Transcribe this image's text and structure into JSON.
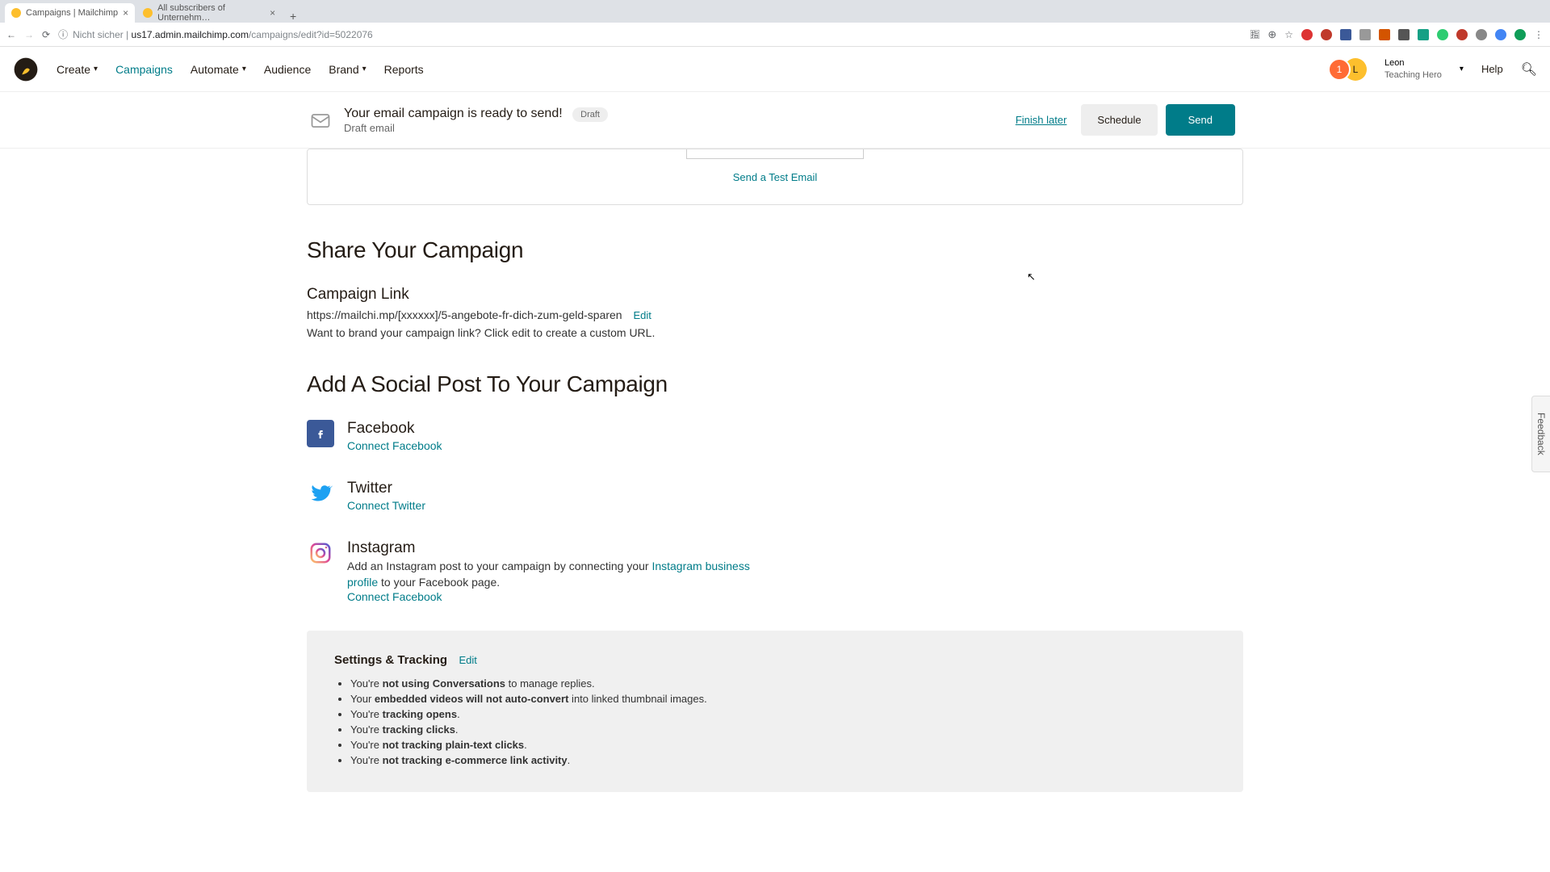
{
  "browser": {
    "tabs": [
      {
        "title": "Campaigns | Mailchimp"
      },
      {
        "title": "All subscribers of Unternehm…"
      }
    ],
    "url": {
      "prefix": "Nicht sicher | ",
      "host": "us17.admin.mailchimp.com",
      "path": "/campaigns/edit?id=5022076"
    }
  },
  "header": {
    "nav": {
      "create": "Create",
      "campaigns": "Campaigns",
      "automate": "Automate",
      "audience": "Audience",
      "brand": "Brand",
      "reports": "Reports"
    },
    "user": {
      "name": "Leon",
      "org": "Teaching Hero"
    },
    "help": "Help",
    "avatars": {
      "a1": "1",
      "a2": "L"
    }
  },
  "subheader": {
    "title": "Your email campaign is ready to send!",
    "badge": "Draft",
    "subtitle": "Draft email",
    "finish": "Finish later",
    "schedule": "Schedule",
    "send": "Send"
  },
  "preview": {
    "testLink": "Send a Test Email"
  },
  "share": {
    "title": "Share Your Campaign",
    "linkTitle": "Campaign Link",
    "url": "https://mailchi.mp/[xxxxxx]/5-angebote-fr-dich-zum-geld-sparen",
    "edit": "Edit",
    "helper": "Want to brand your campaign link? Click edit to create a custom URL."
  },
  "social": {
    "title": "Add A Social Post To Your Campaign",
    "facebook": {
      "name": "Facebook",
      "link": "Connect Facebook"
    },
    "twitter": {
      "name": "Twitter",
      "link": "Connect Twitter"
    },
    "instagram": {
      "name": "Instagram",
      "desc1": "Add an Instagram post to your campaign by connecting your ",
      "descLink": "Instagram business profile",
      "desc2": " to your Facebook page.",
      "link": "Connect Facebook"
    }
  },
  "settings": {
    "title": "Settings & Tracking",
    "edit": "Edit",
    "items": [
      {
        "pre": "You're ",
        "bold": "not using Conversations",
        "post": " to manage replies."
      },
      {
        "pre": "Your ",
        "bold": "embedded videos will not auto-convert",
        "post": " into linked thumbnail images."
      },
      {
        "pre": "You're ",
        "bold": "tracking opens",
        "post": "."
      },
      {
        "pre": "You're ",
        "bold": "tracking clicks",
        "post": "."
      },
      {
        "pre": "You're ",
        "bold": "not tracking plain-text clicks",
        "post": "."
      },
      {
        "pre": "You're ",
        "bold": "not tracking e-commerce link activity",
        "post": "."
      }
    ]
  },
  "feedback": "Feedback"
}
